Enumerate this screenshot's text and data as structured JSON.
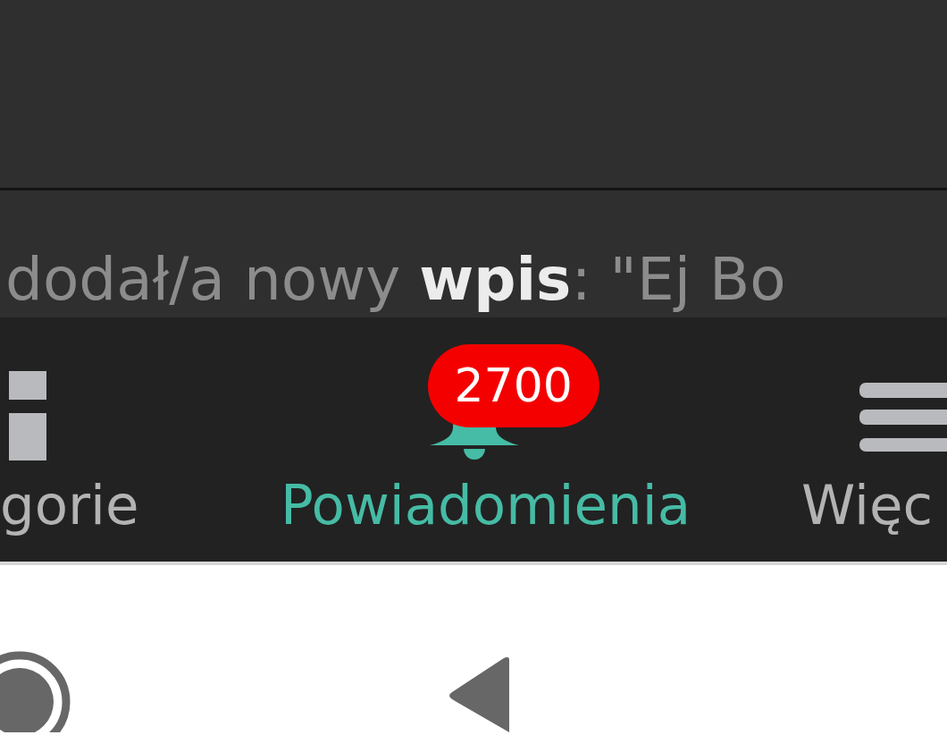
{
  "feed": {
    "text": "dodał/a nowy **wpis**: \"Ej Bo"
  },
  "bottom_nav": {
    "items": [
      {
        "kind": "grid",
        "label": "gorie",
        "selected": false
      },
      {
        "kind": "bell",
        "label": "Powiadomienia",
        "selected": true,
        "badge": "2700"
      },
      {
        "kind": "menu",
        "label": "Więc",
        "selected": false
      }
    ]
  }
}
